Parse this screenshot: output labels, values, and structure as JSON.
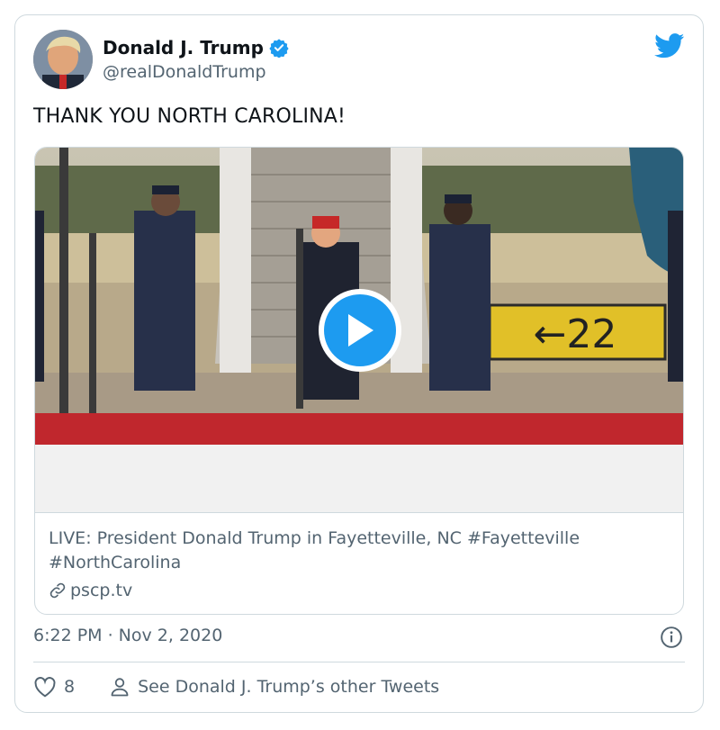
{
  "tweet": {
    "author_name": "Donald J. Trump",
    "handle": "@realDonaldTrump",
    "text": "THANK YOU NORTH CAROLINA!",
    "timestamp": "6:22 PM · Nov 2, 2020"
  },
  "link_card": {
    "title": "LIVE: President Donald Trump in Fayetteville, NC #Fayetteville #NorthCarolina",
    "domain": "pscp.tv",
    "sign_text": "←22"
  },
  "actions": {
    "like_count": "8",
    "other_tweets_label": "See Donald J. Trump’s other Tweets"
  },
  "colors": {
    "twitter_blue": "#1d9bf0",
    "muted_text": "#536471",
    "border": "#cfd9de"
  },
  "icons": [
    "verified-badge-icon",
    "twitter-bird-icon",
    "play-icon",
    "link-icon",
    "info-icon",
    "heart-icon",
    "person-icon"
  ]
}
